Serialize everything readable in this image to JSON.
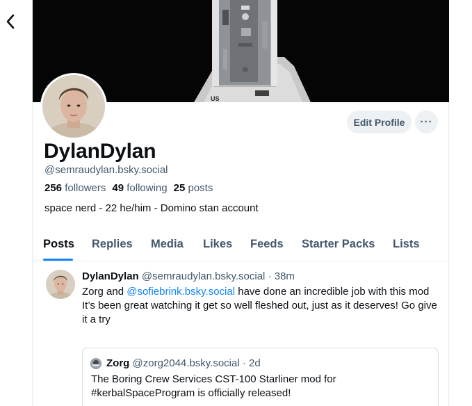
{
  "nav": {
    "back_icon": "chevron-left-icon"
  },
  "profile": {
    "display_name": "DylanDylan",
    "handle": "@semraudylan.bsky.social",
    "stats": {
      "followers_count": "256",
      "followers_label": "followers",
      "following_count": "49",
      "following_label": "following",
      "posts_count": "25",
      "posts_label": "posts"
    },
    "bio": "space nerd - 22 he/him - Domino stan account",
    "edit_label": "Edit Profile",
    "more_label": "···"
  },
  "tabs": [
    {
      "label": "Posts",
      "active": true
    },
    {
      "label": "Replies"
    },
    {
      "label": "Media"
    },
    {
      "label": "Likes"
    },
    {
      "label": "Feeds"
    },
    {
      "label": "Starter Packs"
    },
    {
      "label": "Lists"
    }
  ],
  "post": {
    "author": "DylanDylan",
    "handle": "@semraudylan.bsky.social",
    "time": "· 38m",
    "text_before_mention": "Zorg and ",
    "mention": "@sofiebrink.bsky.social",
    "text_after_mention": " have done an incredible job with this mod",
    "text_line2": "It’s been great watching it get so well fleshed out, just as it deserves! Go give it a try",
    "quote": {
      "author": "Zorg",
      "handle": "@zorg2044.bsky.social",
      "time": "· 2d",
      "text": "The Boring Crew Services CST-100 Starliner mod for #kerbalSpaceProgram is officially released!"
    }
  },
  "colors": {
    "accent": "#1083fe",
    "text_primary": "#0b0f14",
    "text_secondary": "#42576c",
    "button_bg": "#eef1f4",
    "border": "#e8ecf0"
  }
}
